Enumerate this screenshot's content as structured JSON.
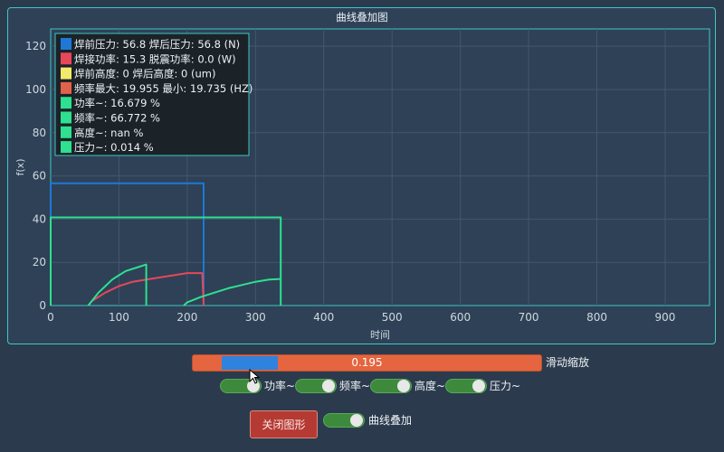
{
  "chart_data": {
    "type": "line",
    "title": "曲线叠加图",
    "xlabel": "时间",
    "ylabel": "f(x)",
    "xlim": [
      0,
      965
    ],
    "ylim": [
      0,
      128
    ],
    "xticks": [
      0,
      100,
      200,
      300,
      400,
      500,
      600,
      700,
      800,
      900
    ],
    "yticks": [
      0,
      20,
      40,
      60,
      80,
      100,
      120
    ],
    "grid": true,
    "legend_position": "top-left",
    "legend": [
      {
        "label": "焊前压力: 56.8 焊后压力: 56.8 (N)",
        "color": "#1f78d6"
      },
      {
        "label": "焊接功率: 15.3 脱震功率: 0.0 (W)",
        "color": "#e8475a"
      },
      {
        "label": "焊前高度: 0 焊后高度: 0 (um)",
        "color": "#f3e96b"
      },
      {
        "label": "频率最大: 19.955 最小: 19.735 (HZ)",
        "color": "#e0624a"
      },
      {
        "label": "功率~: 16.679 %",
        "color": "#2ee08f"
      },
      {
        "label": "频率~: 66.772 %",
        "color": "#2ee08f"
      },
      {
        "label": "高度~: nan %",
        "color": "#2ee08f"
      },
      {
        "label": "压力~: 0.014 %",
        "color": "#2ee08f"
      }
    ],
    "series": [
      {
        "color": "#1f78d6",
        "x": [
          0,
          0,
          100,
          224,
          224
        ],
        "y": [
          0,
          56.6,
          56.6,
          56.6,
          0
        ]
      },
      {
        "color": "#e8475a",
        "x": [
          55,
          60,
          80,
          100,
          120,
          140,
          160,
          180,
          200,
          222,
          224
        ],
        "y": [
          0,
          2,
          6,
          9,
          11,
          12,
          13,
          14,
          15,
          15,
          0
        ]
      },
      {
        "color": "#2ee08f",
        "x": [
          0,
          0,
          337,
          337
        ],
        "y": [
          0,
          40.8,
          40.8,
          0
        ]
      },
      {
        "color": "#2ee08f",
        "x": [
          55,
          60,
          70,
          80,
          90,
          100,
          110,
          120,
          130,
          140,
          140
        ],
        "y": [
          0,
          2,
          6,
          9,
          12,
          14,
          16,
          17,
          18,
          19,
          0
        ]
      },
      {
        "color": "#2ee08f",
        "x": [
          195,
          200,
          220,
          240,
          260,
          280,
          300,
          320,
          336
        ],
        "y": [
          0,
          1.5,
          4,
          6,
          8,
          9.5,
          11,
          12,
          12.3
        ]
      }
    ]
  },
  "controls": {
    "slider_value": "0.195",
    "slider_label": "滑动缩放",
    "toggles": [
      {
        "label": "功率~"
      },
      {
        "label": "频率~"
      },
      {
        "label": "高度~"
      },
      {
        "label": "压力~"
      }
    ],
    "close_button": "关闭图形",
    "overlay_toggle": "曲线叠加"
  }
}
